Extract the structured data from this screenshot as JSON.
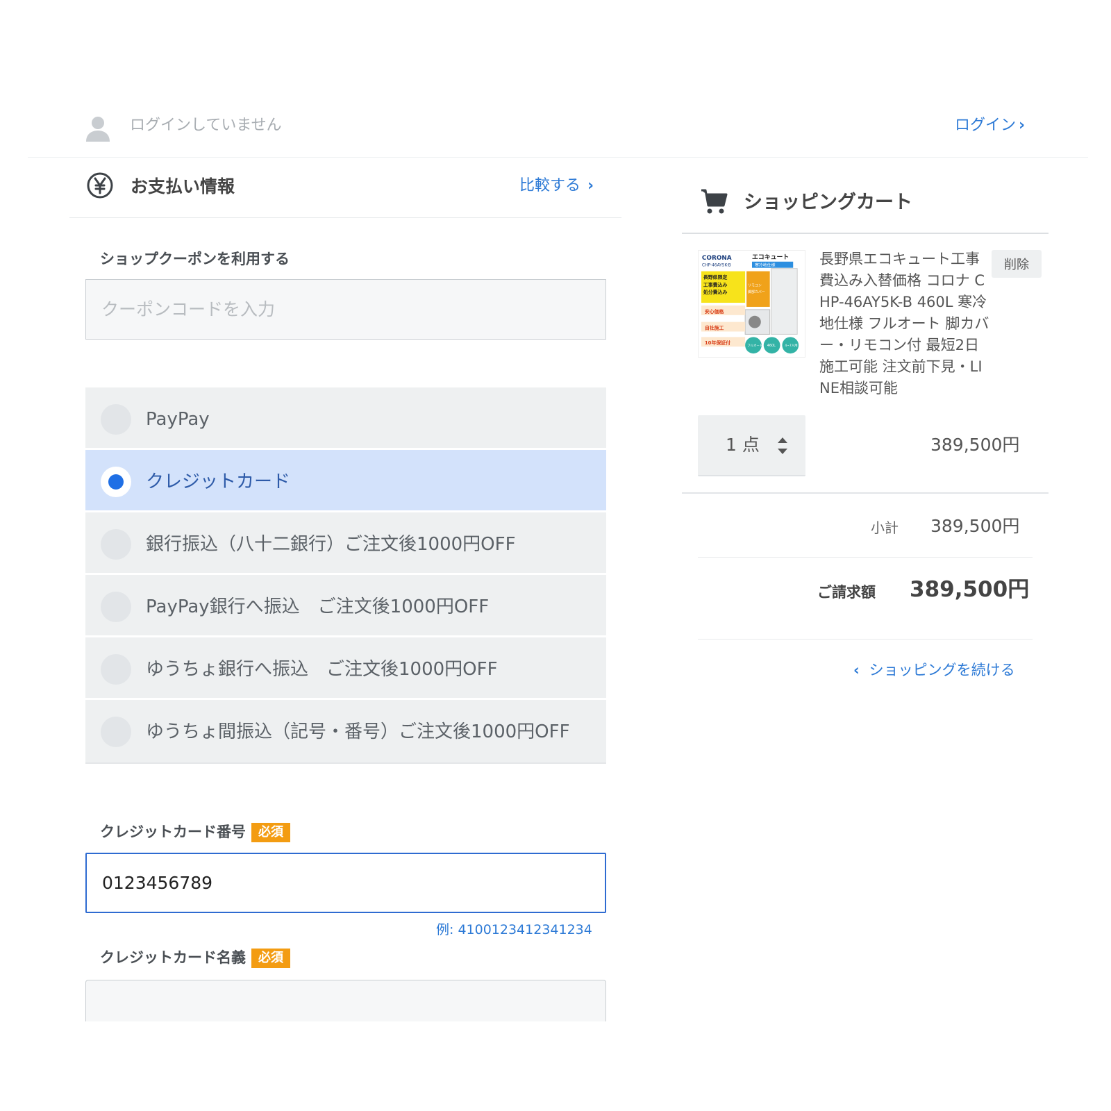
{
  "login": {
    "status": "ログインしていません",
    "link_label": "ログイン",
    "chevron": "›"
  },
  "payment": {
    "title": "お支払い情報",
    "compare_label": "比較する",
    "chevron": "›",
    "coupon_label": "ショップクーポンを利用する",
    "coupon_placeholder": "クーポンコードを入力",
    "options": [
      {
        "label": "PayPay",
        "selected": false
      },
      {
        "label": "クレジットカード",
        "selected": true
      },
      {
        "label": "銀行振込（八十二銀行）ご注文後1000円OFF",
        "selected": false
      },
      {
        "label": "PayPay銀行へ振込　ご注文後1000円OFF",
        "selected": false
      },
      {
        "label": "ゆうちょ銀行へ振込　ご注文後1000円OFF",
        "selected": false
      },
      {
        "label": "ゆうちょ間振込（記号・番号）ご注文後1000円OFF",
        "selected": false
      }
    ],
    "cc_number_label": "クレジットカード番号",
    "cc_name_label": "クレジットカード名義",
    "required_badge": "必須",
    "cc_number_value": "0123456789",
    "cc_example": "例: 4100123412341234"
  },
  "cart": {
    "title": "ショッピングカート",
    "product_name": "長野県エコキュート工事費込み入替価格 コロナ CHP-46AY5K-B 460L 寒冷地仕様 フルオート 脚カバー・リモコン付 最短2日施工可能 注文前下見・LINE相談可能",
    "thumb_text": {
      "brand": "CORONA",
      "model": "CHP-46AY5K-B",
      "eco": "エコキュート",
      "cold": "寒冷地仕様",
      "badge1": "長野県限定",
      "badge2": "工事費込み",
      "badge3": "処分費込み",
      "badge4": "リモコン",
      "badge5": "脚部カバー",
      "line1": "安心価格",
      "line2": "自社施工",
      "line3": "10年保証付",
      "circle1": "フルオート",
      "circle2": "460L",
      "circle3": "4~7人用"
    },
    "delete_label": "削除",
    "quantity": "1 点",
    "line_price": "389,500円",
    "subtotal_label": "小計",
    "subtotal_value": "389,500円",
    "total_label": "ご請求額",
    "total_value": "389,500円",
    "continue_label": "ショッピングを続ける",
    "back_chevron": "‹"
  },
  "colors": {
    "accent": "#2d7ad6",
    "selected_bg": "#d3e2fb",
    "radio_selected": "#1f6fe5",
    "badge": "#f39c12"
  },
  "icons": {
    "user": "user-icon",
    "yen": "yen-icon",
    "cart": "cart-icon",
    "sort": "sort-arrows-icon"
  }
}
